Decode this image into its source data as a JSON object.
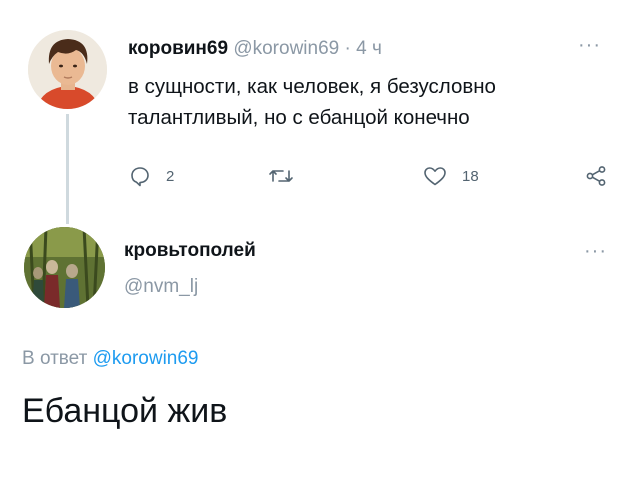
{
  "tweet": {
    "author_name": "коровин69",
    "author_handle": "@korowin69",
    "separator": "·",
    "time": "4 ч",
    "more": "···",
    "text_line1": "в сущности, как человек, я безусловно",
    "text_line2": "талантливый, но с ебанцой конечно",
    "replies": "2",
    "likes": "18"
  },
  "reply": {
    "author_name": "кровьтополей",
    "author_handle": "@nvm_lj",
    "more": "···",
    "reply_label": "В ответ",
    "reply_mention": "@korowin69",
    "text": "Ебанцой жив"
  },
  "colors": {
    "text": "#0f1419",
    "muted": "#8b98a5",
    "link": "#1d9bf0",
    "thread_line": "#cfd9de"
  }
}
